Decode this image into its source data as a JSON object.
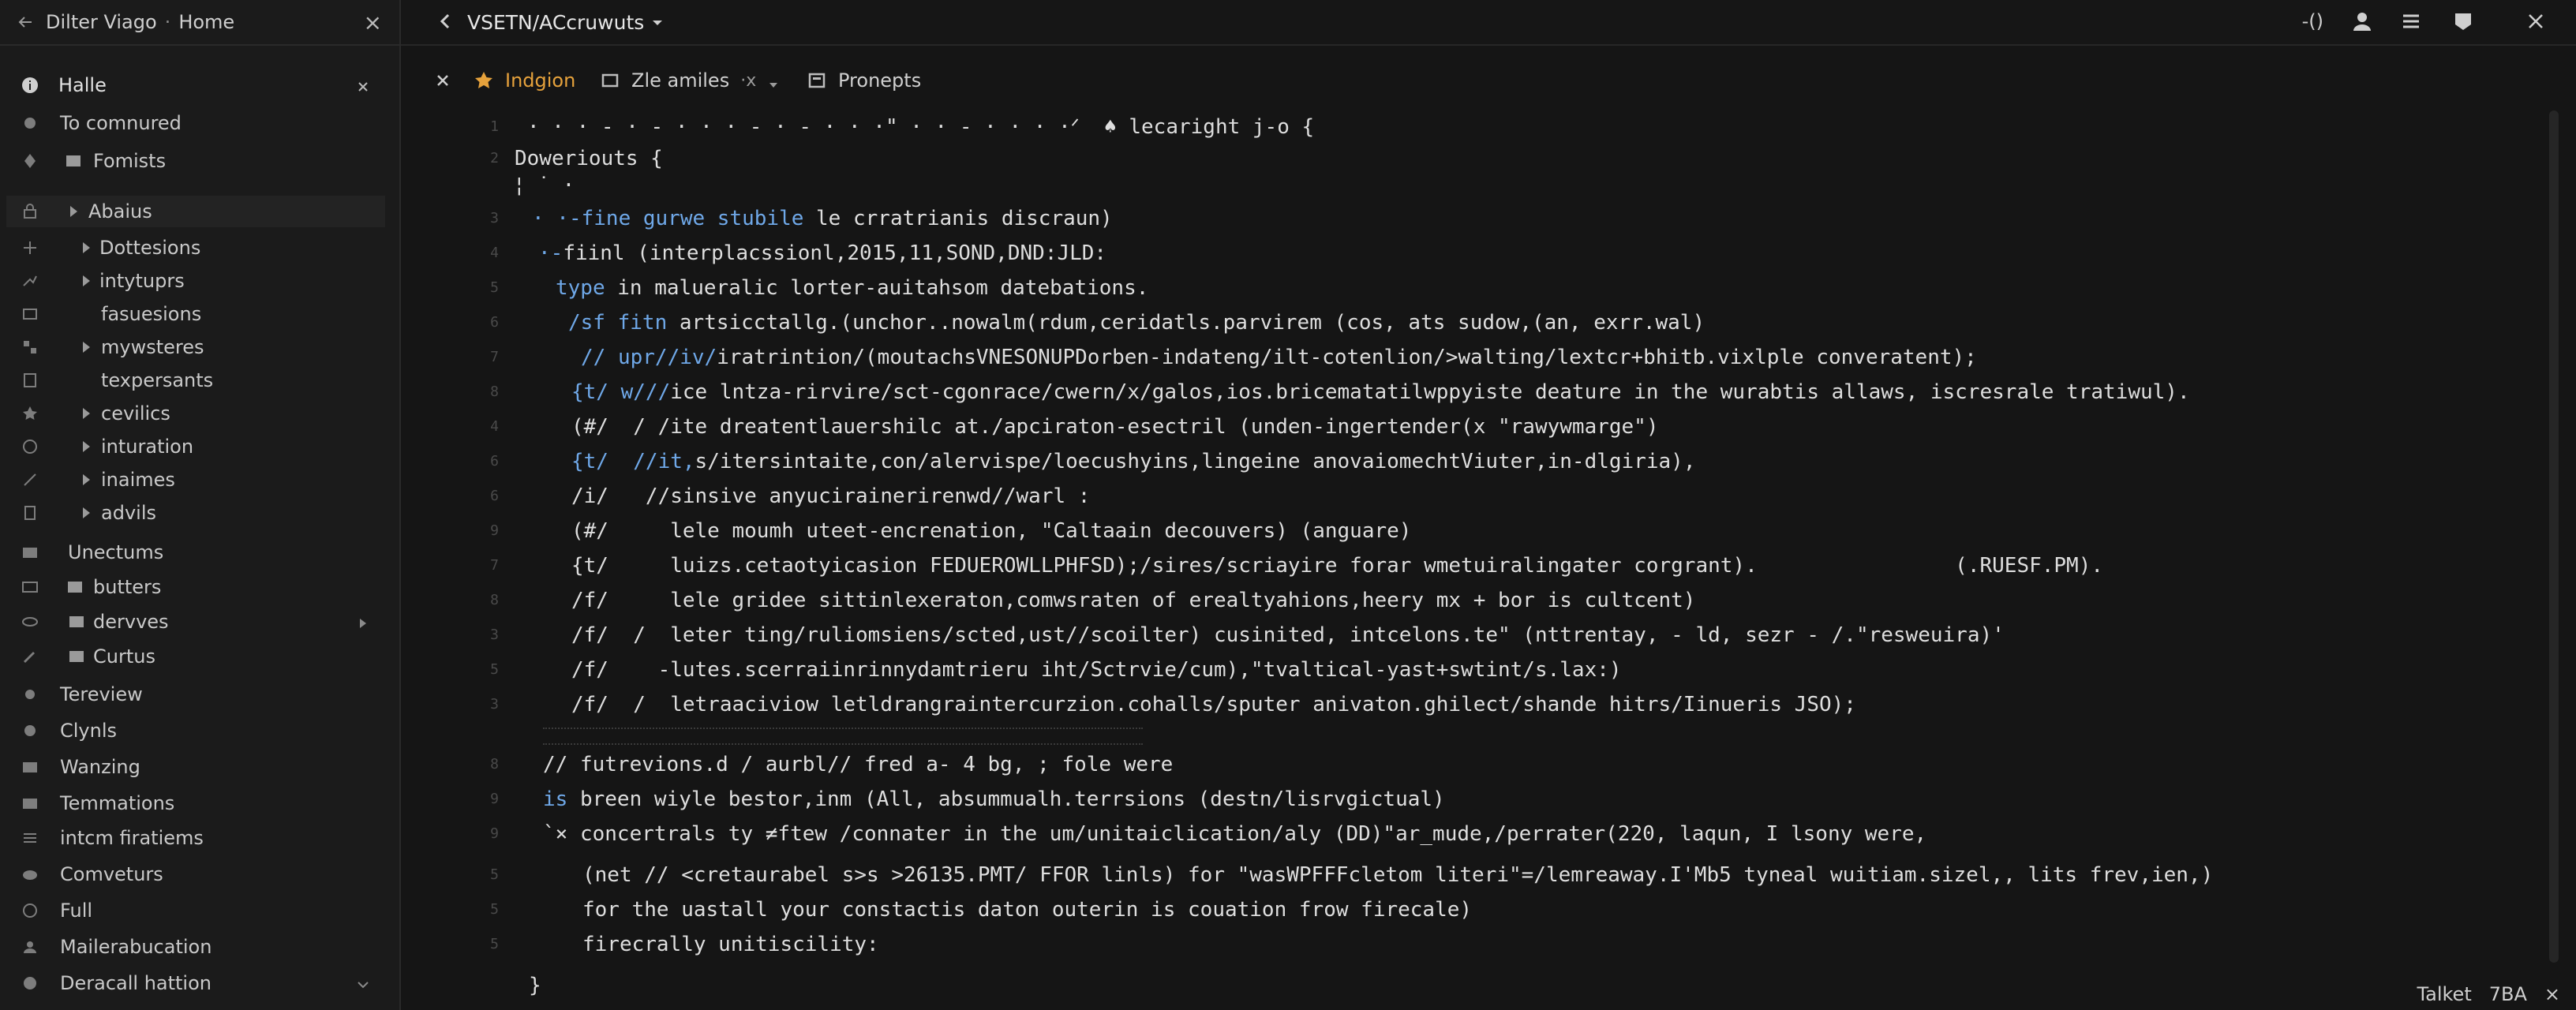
{
  "sidebar": {
    "header": {
      "title": "Dilter Viago",
      "separator": "·",
      "section": "Home",
      "close": "×"
    },
    "items": [
      {
        "label": "Halle"
      },
      {
        "label": "To comnured"
      },
      {
        "label": "Fomists"
      },
      {
        "label": "Abaius"
      },
      {
        "label": "Dottesions"
      },
      {
        "label": "intytuprs"
      },
      {
        "label": "fasuesions"
      },
      {
        "label": "mywsteres"
      },
      {
        "label": "texpersants"
      },
      {
        "label": "cevilics"
      },
      {
        "label": "inturation"
      },
      {
        "label": "inaimes"
      },
      {
        "label": "advils"
      },
      {
        "label": "Unectums"
      },
      {
        "label": "butters"
      },
      {
        "label": "dervves"
      },
      {
        "label": "Curtus"
      },
      {
        "label": "Tereview"
      },
      {
        "label": "Clynls"
      },
      {
        "label": "Wanzing"
      },
      {
        "label": "Temmations"
      },
      {
        "label": "intcm firatiems"
      },
      {
        "label": "Comveturs"
      },
      {
        "label": "Full"
      },
      {
        "label": "Mailerabucation"
      },
      {
        "label": "Deracall hattion"
      }
    ]
  },
  "topbar": {
    "title": "VSETN/ACcruwuts",
    "readout": "-()"
  },
  "tabs": [
    {
      "label": "Indgion"
    },
    {
      "label": "Zle amiles",
      "suffix": "·x"
    },
    {
      "label": "Pronepts"
    }
  ],
  "editor": {
    "lines": [
      {
        "n": "1",
        "text": "· · · - · - · · · - · - · · ·\" · · - · · · ·ᐟ  ♠ lecaright j-o {"
      },
      {
        "n": "2",
        "text": "Doweriouts {"
      },
      {
        "n": "",
        "text": "¦ ˙ ·"
      },
      {
        "n": "3",
        "pre": "· ·-fine gurwe stubile",
        "text": " le crratrianis discraun)"
      },
      {
        "n": "4",
        "pre": "·-",
        "text": "fiinl (interplacssionl,2015,11,SOND,DND:JLD:"
      },
      {
        "n": "5",
        "pre": "type",
        "text": " in malueralic lorter-auitahsom datebations."
      },
      {
        "n": "6",
        "pre": "/sf fitn",
        "text": " artsicctallg.(unchor..nowalm(rdum,ceridatls.parvirem (cos, ats sudow,(an, exrr.wal)"
      },
      {
        "n": "7",
        "pre": "// upr//iv/",
        "text": "iratrintion/(moutachsVNESONUPDorben-indateng/ilt-cotenlion/>walting/lextcr+bhitb.vixlple converatent);"
      },
      {
        "n": "8",
        "pre": "{t/ w///",
        "text": "ice lntza-rirvire/sct-cgonrace/cwern/x/galos,ios.bricematatilwppyiste deature in the wurabtis allaws, iscresrale tratiwul)."
      },
      {
        "n": "4",
        "text": "(#/  / /ite dreatentlauershilc at./apciraton-esectril (unden-ingertender(x \"rawywmarge\")"
      },
      {
        "n": "6",
        "pre": "{t/  //it,",
        "text": "s/itersintaite,con/alervispe/loecushyins,lingeine anovaiomechtViuter,in-dlgiria),"
      },
      {
        "n": "6",
        "text": "/i/   //sinsive anyucirainerirenwd//warl :"
      },
      {
        "n": "9",
        "text": "(#/     lele moumh uteet-encrenation, \"Caltaain decouvers) (anguare)"
      },
      {
        "n": "7",
        "text": "{t/     luizs.cetaotyicasion FEDUEROWLLPHFSD);/sires/scriayire forar wmetuiralingater corgrant).                (.RUESF.PM)."
      },
      {
        "n": "8",
        "text": "/f/     lele gridee sittinlexeraton,comwsraten of erealtyahions,heery mx + bor is cultcent)"
      },
      {
        "n": "3",
        "text": "/f/  /  leter ting/ruliomsiens/scted,ust//scoilter) cusinited, intcelons.te\" (nttrentay, - ld, sezr - /.\"resweuira)'"
      },
      {
        "n": "5",
        "text": "/f/    -lutes.scerraiinrinnydamtrieru iht/Sctrvie/cum),\"tvaltical-yast+swtint/s.lax:)"
      },
      {
        "n": "3",
        "text": "/f/  /  letraaciviow letldrangraintercurzion.cohalls/sputer anivaton.ghilect/shande hitrs/Iinueris JSO);"
      },
      {
        "n": "8",
        "text": "// futrevions.d / aurbl// fred a- 4 bg, ; fole were"
      },
      {
        "n": "9",
        "pre": "is",
        "text": " breen wiyle bestor,inm (All, absummualh.terrsions (destn/lisrvgictual)"
      },
      {
        "n": "9",
        "text": "`× concertrals ty ≠ftew /connater in the um/unitaiclication/aly (DD)\"ar_mude,/perrater(220, laqun, I lsony were,"
      },
      {
        "n": "5",
        "text": "(net // <cretaurabel s>s >26135.PMT/ FFOR linls) for \"wasWPFFFcletom literi\"=/lemreaway.I'Mb5 tyneal wuitiam.sizel,, lits frev,ien,)"
      },
      {
        "n": "5",
        "text": "for the uastall your constactis daton outerin is couation frow firecale)"
      },
      {
        "n": "5",
        "text": "firecrally unitiscility:"
      },
      {
        "n": "",
        "text": "}"
      }
    ]
  },
  "status": {
    "left": "Talket",
    "right": "7BA",
    "close": "×"
  },
  "icons": {
    "arrow-left": "←",
    "close": "×",
    "chevron-left": "‹",
    "chevron-down": "▾",
    "chevron-right": "▸",
    "user": "person",
    "menu": "≡",
    "star": "★"
  }
}
